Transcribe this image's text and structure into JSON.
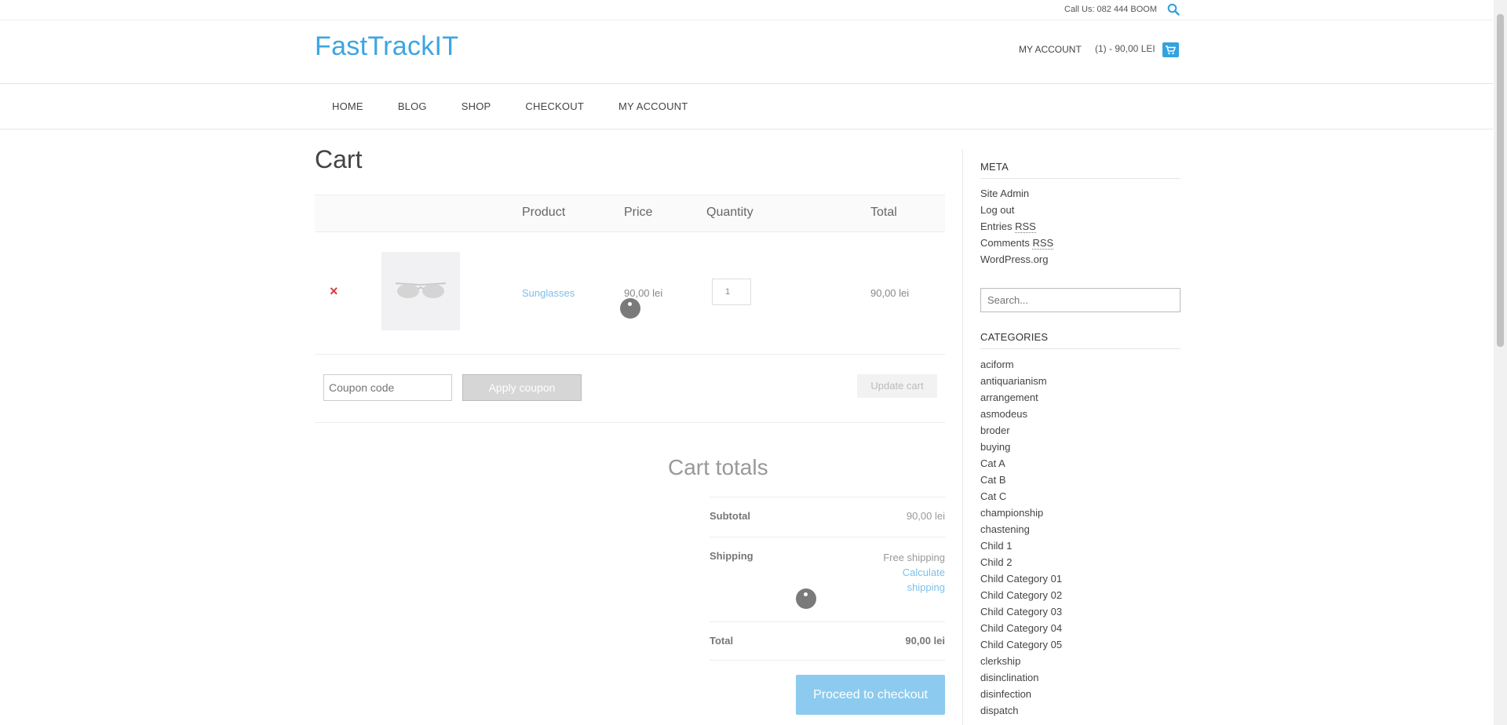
{
  "topbar": {
    "call": "Call Us: 082 444 BOOM"
  },
  "header": {
    "logo": "FastTrackIT",
    "my_account": "MY ACCOUNT",
    "cart_info": "(1) - 90,00 LEI"
  },
  "nav": [
    "HOME",
    "BLOG",
    "SHOP",
    "CHECKOUT",
    "MY ACCOUNT"
  ],
  "cart": {
    "title": "Cart",
    "headers": {
      "product": "Product",
      "price": "Price",
      "quantity": "Quantity",
      "total": "Total"
    },
    "item": {
      "remove": "×",
      "name": "Sunglasses",
      "price": "90,00 lei",
      "quantity": "1",
      "total": "90,00 lei"
    },
    "coupon_placeholder": "Coupon code",
    "apply_coupon": "Apply coupon",
    "update_cart": "Update cart"
  },
  "totals": {
    "title": "Cart totals",
    "subtotal_label": "Subtotal",
    "subtotal_value": "90,00 lei",
    "shipping_label": "Shipping",
    "shipping_value": "Free shipping",
    "calculate_1": "Calculate",
    "calculate_2": "shipping",
    "total_label": "Total",
    "total_value": "90,00 lei",
    "proceed": "Proceed to checkout"
  },
  "sidebar": {
    "meta_title": "META",
    "meta": [
      "Site Admin",
      "Log out",
      "Entries",
      "Comments",
      "WordPress.org"
    ],
    "rss": "RSS",
    "search_placeholder": "Search...",
    "categories_title": "CATEGORIES",
    "categories": [
      "aciform",
      "antiquarianism",
      "arrangement",
      "asmodeus",
      "broder",
      "buying",
      "Cat A",
      "Cat B",
      "Cat C",
      "championship",
      "chastening",
      "Child 1",
      "Child 2",
      "Child Category 01",
      "Child Category 02",
      "Child Category 03",
      "Child Category 04",
      "Child Category 05",
      "clerkship",
      "disinclination",
      "disinfection",
      "dispatch"
    ]
  },
  "colors": {
    "brand": "#3da5e0",
    "link": "#7dbfe9",
    "remove": "#e0393e",
    "proceed": "#8ccbef"
  },
  "icons": {
    "search": "search-icon",
    "cart": "cart-icon",
    "product_image": "sunglasses-image"
  }
}
